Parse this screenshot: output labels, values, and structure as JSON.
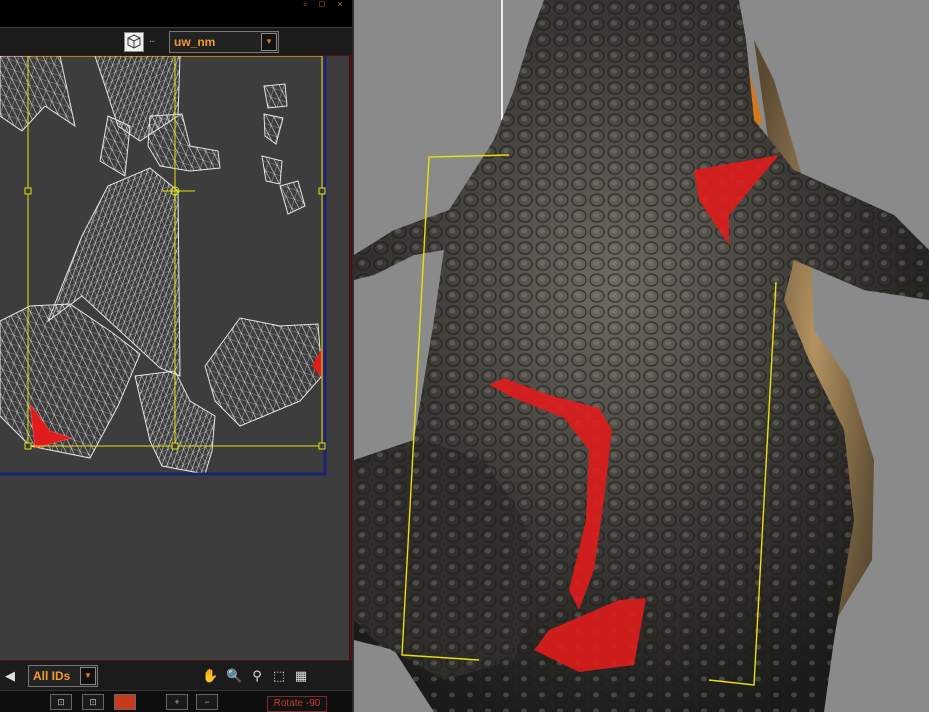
{
  "uv_editor": {
    "map_select": {
      "value": "uw_nm"
    },
    "filter_select": {
      "value": "All IDs"
    },
    "rotate_button": {
      "label": "Rotate -90"
    },
    "tool_icons": [
      "pan-hand-icon",
      "zoom-icon",
      "zoom-region-icon",
      "zoom-extents-icon",
      "grid-icon"
    ]
  },
  "viewport": {
    "object": "crocodile-body-textured"
  },
  "colors": {
    "accent": "#f39c2b",
    "selection": "#e01c1c",
    "gizmo": "#e8e010",
    "uv_wire": "#e6e6e6",
    "uv_bg": "#3d3d3d",
    "viewport_bg": "#8a8a8a"
  }
}
